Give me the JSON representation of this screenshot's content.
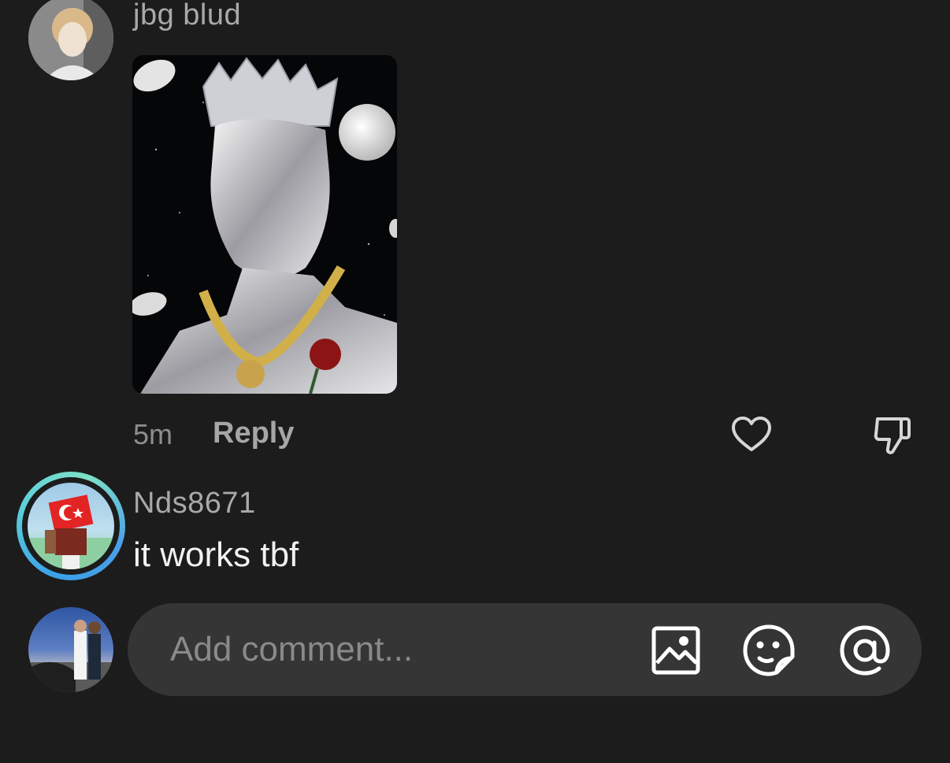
{
  "comments": [
    {
      "username": "jbg blud",
      "avatar_icon": "user-avatar-photo",
      "has_image": true,
      "time": "5m",
      "reply_label": "Reply"
    },
    {
      "username": "Nds8671",
      "avatar_icon": "user-avatar-photo-story-ring",
      "text": "it works tbf"
    }
  ],
  "actions": {
    "like_icon": "heart-outline-icon",
    "dislike_icon": "thumbs-down-outline-icon"
  },
  "composer": {
    "placeholder": "Add comment...",
    "image_icon": "image-icon",
    "sticker_icon": "sticker-face-icon",
    "mention_icon": "at-sign-icon"
  },
  "colors": {
    "background": "#1c1c1c",
    "composer_bg": "#353535",
    "username": "#a9a9a9",
    "comment_text": "#f2f2f2",
    "story_ring_start": "#3aa0e8",
    "story_ring_end": "#7ee1c9"
  }
}
